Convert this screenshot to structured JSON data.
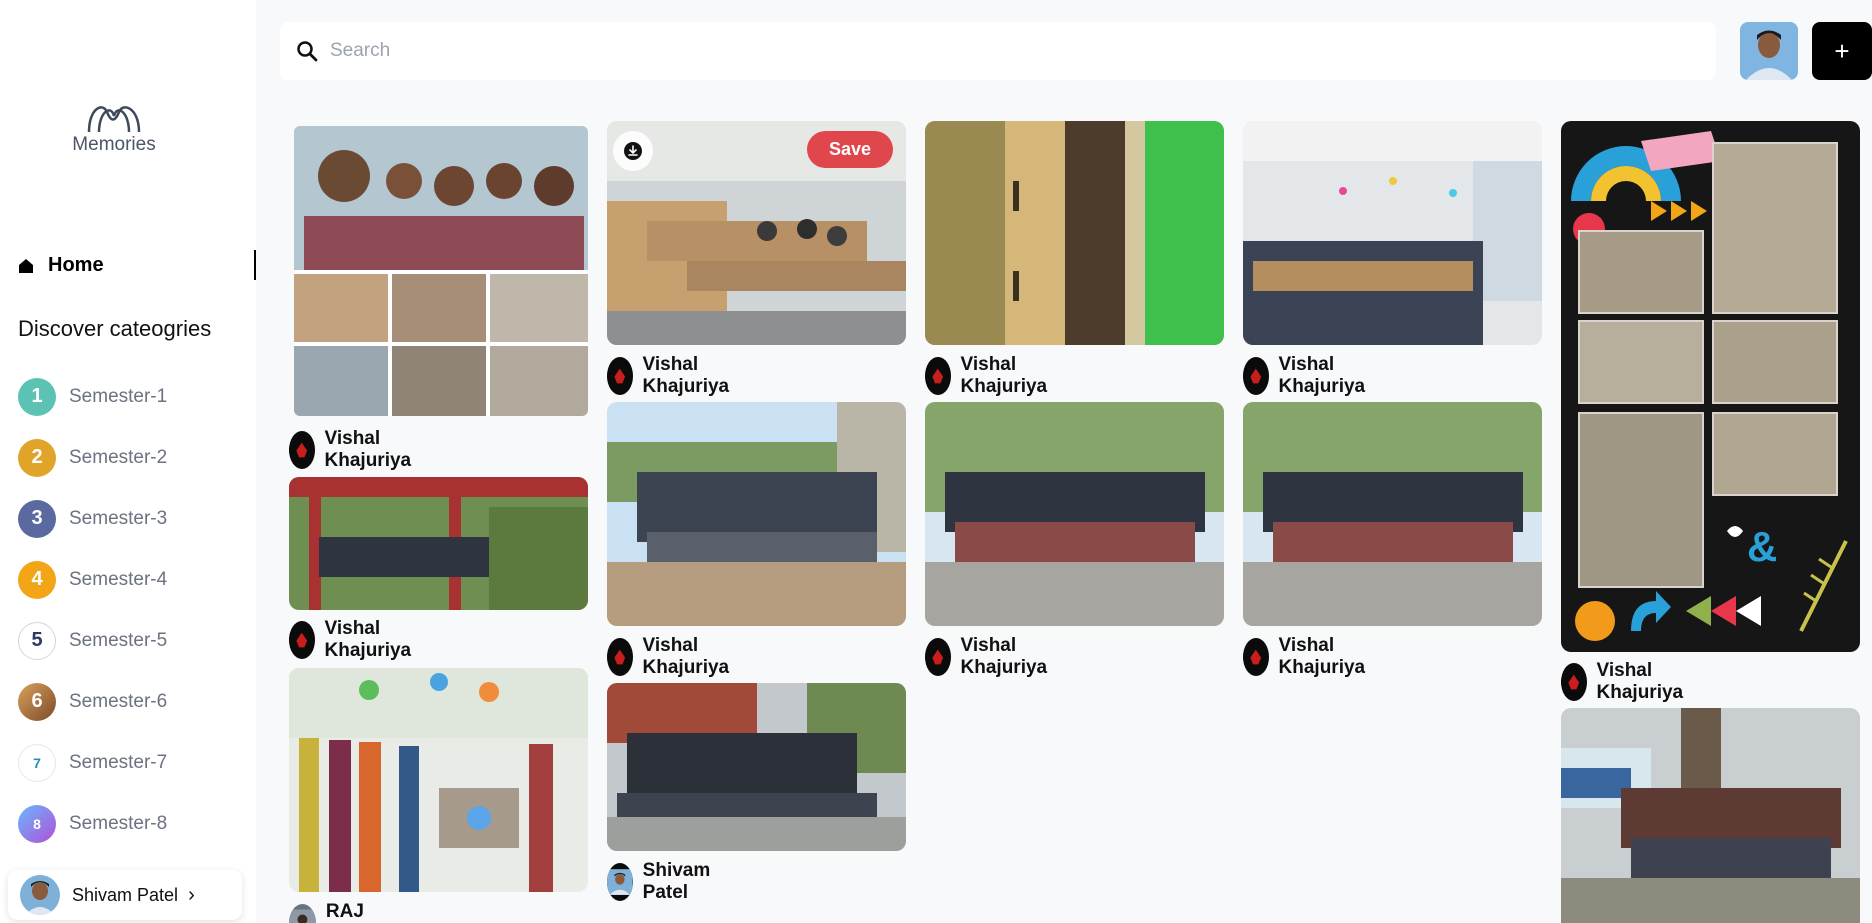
{
  "app": {
    "brand_name": "Memories"
  },
  "sidebar": {
    "home_label": "Home",
    "discover_heading": "Discover cateogries",
    "categories": [
      {
        "label": "Semester-1",
        "color": "#5cc2b4",
        "glyph": "1"
      },
      {
        "label": "Semester-2",
        "color": "#e0a42a",
        "glyph": "2"
      },
      {
        "label": "Semester-3",
        "color": "#5a6aa0",
        "glyph": "3"
      },
      {
        "label": "Semester-4",
        "color": "#f2a516",
        "glyph": "4"
      },
      {
        "label": "Semester-5",
        "color": "#ffffff",
        "glyph": "5"
      },
      {
        "label": "Semester-6",
        "color": "#7c4a2a",
        "glyph": "6"
      },
      {
        "label": "Semester-7",
        "color": "#ffffff",
        "glyph": "7"
      },
      {
        "label": "Semester-8",
        "color": "#ffffff",
        "glyph": "8"
      }
    ],
    "user": {
      "name": "Shivam Patel"
    }
  },
  "header": {
    "search_placeholder": "Search",
    "add_label": "+"
  },
  "feed": {
    "save_label": "Save",
    "pins": [
      {
        "author": "Vishal Khajuriya"
      },
      {
        "author": "Vishal Khajuriya"
      },
      {
        "author": "RAJ ARYAN"
      },
      {
        "author": "Vishal Khajuriya"
      },
      {
        "author": "Vishal Khajuriya"
      },
      {
        "author": "Shivam Patel"
      },
      {
        "author": "Vishal Khajuriya"
      },
      {
        "author": "Vishal Khajuriya"
      },
      {
        "author": "Vishal Khajuriya"
      },
      {
        "author": "Vishal Khajuriya"
      },
      {
        "author": "Vishal Khajuriya"
      },
      {
        "author": ""
      }
    ]
  },
  "colors": {
    "accent_save": "#e0474c",
    "dark_button": "#000000",
    "background": "#f8f9fb"
  },
  "icons": {
    "search": "search-icon",
    "home": "home-icon",
    "download": "download-icon",
    "chevron": "chevron-right-icon",
    "plus": "plus-icon"
  }
}
